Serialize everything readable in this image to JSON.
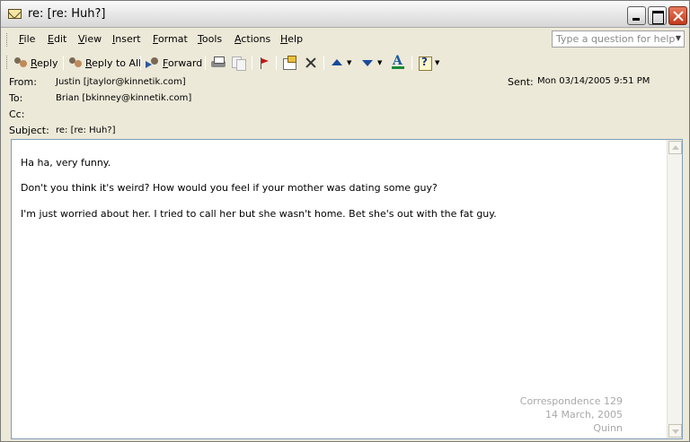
{
  "window": {
    "title": "re: [re: Huh?]"
  },
  "menu": {
    "items": [
      "File",
      "Edit",
      "View",
      "Insert",
      "Format",
      "Tools",
      "Actions",
      "Help"
    ],
    "ask_placeholder": "Type a question for help"
  },
  "toolbar": {
    "reply": "Reply",
    "reply_all": "Reply to All",
    "forward": "Forward"
  },
  "header": {
    "from_label": "From:",
    "from_value": "Justin [jtaylor@kinnetik.com]",
    "to_label": "To:",
    "to_value": "Brian [bkinney@kinnetik.com]",
    "cc_label": "Cc:",
    "cc_value": "",
    "subject_label": "Subject:",
    "subject_value": "re: [re: Huh?]",
    "sent_label": "Sent:",
    "sent_value": "Mon 03/14/2005  9:51 PM"
  },
  "body": {
    "lines": [
      "Ha ha, very funny.",
      "Don't you think it's weird? How would you feel if your mother was dating some guy?",
      "I'm just worried about her. I tried to call her but she wasn't home. Bet she's out with the fat guy."
    ]
  },
  "signature": {
    "line1": "Correspondence 129",
    "line2": "14 March, 2005",
    "line3": "Quinn"
  }
}
